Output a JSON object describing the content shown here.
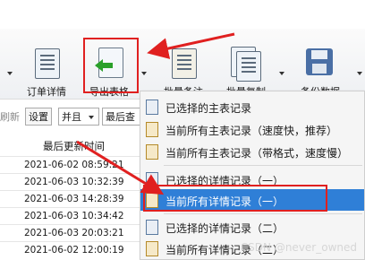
{
  "toolbar": {
    "order_detail": "订单详情",
    "export_table": "导出表格",
    "batch_note": "批量备注",
    "batch_copy": "批量复制",
    "backup_data": "备份数据"
  },
  "filter": {
    "refresh_fragment": "刷新",
    "settings_label": "设置",
    "and_select": "并且",
    "latest_search": "最后查"
  },
  "grid": {
    "column_header": "最后更新时间",
    "rows": [
      "2021-06-02 08:59:21",
      "2021-06-03 10:32:39",
      "2021-06-03 14:28:39",
      "2021-06-03 10:34:42",
      "2021-06-03 20:03:21",
      "2021-06-02 12:00:19"
    ]
  },
  "menu": {
    "items": [
      "已选择的主表记录",
      "当前所有主表记录（速度快，推荐）",
      "当前所有主表记录（带格式，速度慢）",
      "已选择的详情记录（一）",
      "当前所有详情记录（一）",
      "已选择的详情记录（二）",
      "当前所有详情记录（二）"
    ],
    "highlight_index": 4
  },
  "watermark": "CSDN @never_owned",
  "colors": {
    "highlight": "#2f7fd7",
    "annotation_red": "#e02020"
  }
}
